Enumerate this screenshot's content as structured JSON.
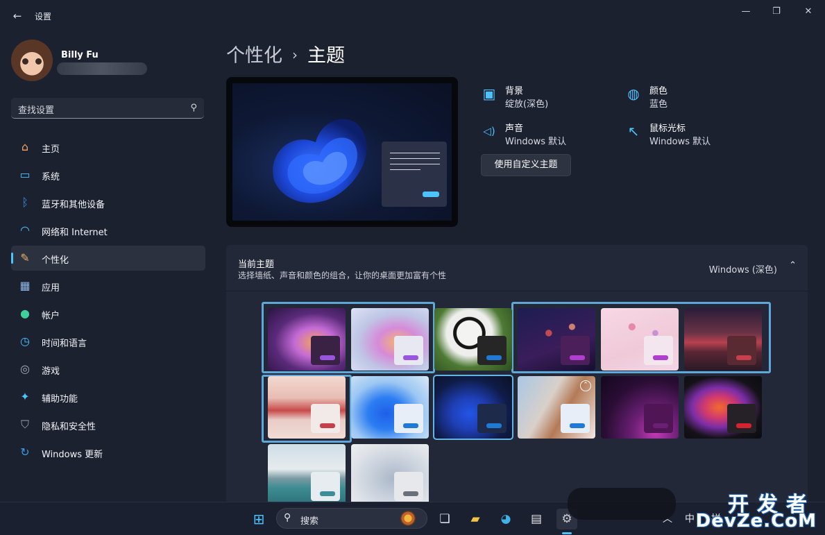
{
  "window": {
    "title": "设置",
    "back_glyph": "←",
    "minimize": "—",
    "maximize": "❐",
    "close": "✕"
  },
  "profile": {
    "name": "Billy Fu"
  },
  "search": {
    "placeholder": "查找设置"
  },
  "sidebar": {
    "items": [
      {
        "label": "主页",
        "icon": "home-icon",
        "color": "#f4a261",
        "glyph": "⌂"
      },
      {
        "label": "系统",
        "icon": "monitor-icon",
        "color": "#4cc2ff",
        "glyph": "▭"
      },
      {
        "label": "蓝牙和其他设备",
        "icon": "bluetooth-icon",
        "color": "#3a8ee6",
        "glyph": "ᛒ"
      },
      {
        "label": "网络和 Internet",
        "icon": "wifi-icon",
        "color": "#4cc2ff",
        "glyph": "◠"
      },
      {
        "label": "个性化",
        "icon": "brush-icon",
        "color": "#e8b26a",
        "glyph": "✎"
      },
      {
        "label": "应用",
        "icon": "apps-icon",
        "color": "#8fb8e8",
        "glyph": "▦"
      },
      {
        "label": "帐户",
        "icon": "account-icon",
        "color": "#3fcf9a",
        "glyph": "●"
      },
      {
        "label": "时间和语言",
        "icon": "clock-globe-icon",
        "color": "#4cc2ff",
        "glyph": "◷"
      },
      {
        "label": "游戏",
        "icon": "gamepad-icon",
        "color": "#a6adbb",
        "glyph": "◎"
      },
      {
        "label": "辅助功能",
        "icon": "accessibility-icon",
        "color": "#4cc2ff",
        "glyph": "✦"
      },
      {
        "label": "隐私和安全性",
        "icon": "shield-icon",
        "color": "#9aa1ad",
        "glyph": "⛉"
      },
      {
        "label": "Windows 更新",
        "icon": "update-icon",
        "color": "#3a9ae6",
        "glyph": "↻"
      }
    ],
    "active_index": 4
  },
  "breadcrumb": {
    "parent": "个性化",
    "separator": "›",
    "current": "主题"
  },
  "properties": [
    {
      "title": "背景",
      "value": "绽放(深色)",
      "icon": "image-icon",
      "glyph": "▣"
    },
    {
      "title": "颜色",
      "value": "蓝色",
      "icon": "palette-icon",
      "glyph": "◍"
    },
    {
      "title": "声音",
      "value": "Windows 默认",
      "icon": "speaker-icon",
      "glyph": "◁)"
    },
    {
      "title": "鼠标光标",
      "value": "Windows 默认",
      "icon": "cursor-icon",
      "glyph": "↖"
    }
  ],
  "custom_theme_button": "使用自定义主题",
  "theme_panel": {
    "title": "当前主题",
    "description": "选择墙纸、声音和颜色的组合，让你的桌面更加富有个性",
    "value": "Windows (深色)",
    "chevron": "⌃"
  },
  "themes": [
    {
      "name": "glow-dark",
      "bg": "radial-gradient(ellipse at 60% 55%, #f4a35c 0%, #c56bd6 30%, #5a2a7a 60%, #2a1440 100%)",
      "card": "#3a2244",
      "accent": "#9a55e0"
    },
    {
      "name": "glow-light",
      "bg": "radial-gradient(ellipse at 60% 55%, #f6b46a 0%, #d68ad8 30%, #bfc6e6 60%, #dde3f2 100%)",
      "card": "#e8e8f2",
      "accent": "#9a55e0"
    },
    {
      "name": "panda",
      "bg": "radial-gradient(circle at 45% 40%, #f3f3f1 0 22%, #151515 23% 28%, #eeeeec 29% 40%, #4e7a34 60%, #2c4c1f 100%)",
      "card": "#262626",
      "accent": "#1f7ad6"
    },
    {
      "name": "planets-dark",
      "bg": "radial-gradient(circle at 40% 40%, #c14a52 0 5%, transparent 6%), radial-gradient(circle at 70% 30%, #d08070 0 4%, transparent 5%), linear-gradient(160deg,#1d1d52,#3a1d5a 60%,#160f30)",
      "card": "#4b1f5a",
      "accent": "#b03fd0"
    },
    {
      "name": "planets-light",
      "bg": "radial-gradient(circle at 40% 30%, #e589a8 0 5%, transparent 6%), radial-gradient(circle at 70% 40%, #c98fd8 0 4%, transparent 5%), linear-gradient(160deg,#f7d8e4,#f0c9d8 60%,#f2d7e6)",
      "card": "#f3e6ef",
      "accent": "#b03fd0"
    },
    {
      "name": "dunes-dark",
      "bg": "linear-gradient(180deg,#2a1d38 0%,#6b3346 40%,#b8414f 55%,#5a2634 70%,#2a1a26 100%)",
      "card": "#5a2a33",
      "accent": "#c6404c"
    },
    {
      "name": "dunes-light",
      "bg": "linear-gradient(180deg,#f2d9d0 0%,#e8bdb4 35%,#c84a4a 55%,#e8cdc6 70%,#f0dcd6 100%)",
      "card": "#f2e9e9",
      "accent": "#c6404c"
    },
    {
      "name": "bloom-light",
      "bg": "radial-gradient(ellipse at 45% 60%, #1e5fe8 0%, #2c7df2 30%, #9cc7f3 60%, #d8e8f6 100%)",
      "card": "#e8eef7",
      "accent": "#1f7ad6"
    },
    {
      "name": "bloom-dark",
      "bg": "radial-gradient(ellipse at 45% 60%, #2255e6 0%, #1f3fb6 30%, #0f1c48 65%, #0b1024 100%)",
      "card": "#1d2a4a",
      "accent": "#1f7ad6"
    },
    {
      "name": "spring",
      "bg": "linear-gradient(120deg,#a9c7e6 0%,#d9d0c9 40%,#b47a56 60%,#f3e8e6 100%)",
      "card": "#e8eef7",
      "accent": "#1f7ad6"
    },
    {
      "name": "flow-dark",
      "bg": "radial-gradient(ellipse at 70% 90%, #c43bb6 0%, #6a1f74 30%, #2a0d34 65%, #140720 100%)",
      "card": "#4f1554",
      "accent": "#6a1f74"
    },
    {
      "name": "captured-motion",
      "bg": "radial-gradient(ellipse at 45% 50%, #f36a2d 0%, #d1396e 25%, #7c2ea8 45%, #141218 70%, #0c0c10 100%)",
      "card": "#262126",
      "accent": "#d3232e"
    },
    {
      "name": "lake",
      "bg": "linear-gradient(180deg,#cfdde6 0%,#e6ecef 40%,#7a9aa3 55%,#3f8c93 70%,#2a6e78 100%)",
      "card": "#e6ecef",
      "accent": "#3e8e9a"
    },
    {
      "name": "sculpture",
      "bg": "radial-gradient(ellipse at 55% 55%, #aab7c9 0%, #c9d1dc 40%, #dfe3e8 70%, #eceef1 100%)",
      "card": "#e6e8ec",
      "accent": "#6a7078"
    }
  ],
  "taskbar": {
    "search_label": "搜索",
    "search_glyph": "⚲",
    "tray": {
      "chevron": "︿",
      "ime": "中",
      "ime2": "拼"
    }
  },
  "watermark": {
    "top": "开发者",
    "bottom": "DevZe.CoM"
  }
}
